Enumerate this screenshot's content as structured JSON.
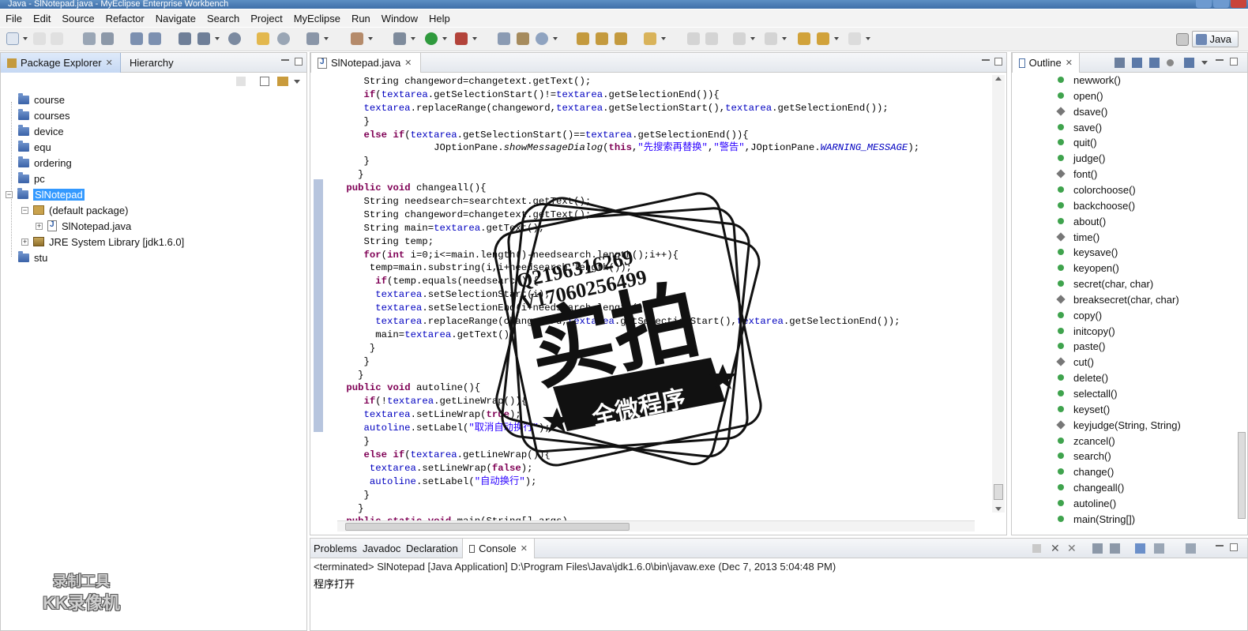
{
  "window": {
    "title": "Java - SlNotepad.java - MyEclipse Enterprise Workbench"
  },
  "menu": [
    "File",
    "Edit",
    "Source",
    "Refactor",
    "Navigate",
    "Search",
    "Project",
    "MyEclipse",
    "Run",
    "Window",
    "Help"
  ],
  "perspective": {
    "label": "Java"
  },
  "package_explorer": {
    "tabs": [
      "Package Explorer",
      "Hierarchy"
    ],
    "items": [
      {
        "label": "course"
      },
      {
        "label": "courses"
      },
      {
        "label": "device"
      },
      {
        "label": "equ"
      },
      {
        "label": "ordering"
      },
      {
        "label": "pc"
      },
      {
        "label": "SlNotepad"
      },
      {
        "label": "(default package)"
      },
      {
        "label": "SlNotepad.java"
      },
      {
        "label": "JRE System Library [jdk1.6.0]"
      },
      {
        "label": "stu"
      }
    ]
  },
  "editor": {
    "tab": "SlNotepad.java",
    "lines": [
      "    String changeword=changetext.getText();",
      "    if(textarea.getSelectionStart()!=textarea.getSelectionEnd()){",
      "    textarea.replaceRange(changeword,textarea.getSelectionStart(),textarea.getSelectionEnd());",
      "    }",
      "    else if(textarea.getSelectionStart()==textarea.getSelectionEnd()){",
      "                JOptionPane.showMessageDialog(this,\"先搜索再替换\",\"警告\",JOptionPane.WARNING_MESSAGE);",
      "    }",
      "   }",
      " public void changeall(){",
      "    String needsearch=searchtext.getText();",
      "    String changeword=changetext.getText();",
      "    String main=textarea.getText();",
      "    String temp;",
      "    for(int i=0;i<=main.length()-needsearch.length();i++){",
      "     temp=main.substring(i,i+needsearch.length());",
      "      if(temp.equals(needsearch)){",
      "      textarea.setSelectionStart(i);",
      "      textarea.setSelectionEnd(i+needsearch.length());",
      "      textarea.replaceRange(changeword,textarea.getSelectionStart(),textarea.getSelectionEnd());",
      "      main=textarea.getText();",
      "     }",
      "    }",
      "   }",
      " public void autoline(){",
      "    if(!textarea.getLineWrap()){",
      "    textarea.setLineWrap(true);",
      "    autoline.setLabel(\"取消自动换行\");",
      "    }",
      "    else if(textarea.getLineWrap()){",
      "     textarea.setLineWrap(false);",
      "     autoline.setLabel(\"自动换行\");",
      "    }",
      "   }",
      " public static void main(String[] args)"
    ]
  },
  "outline": {
    "tab": "Outline",
    "items": [
      {
        "label": "newwork()",
        "kind": "public"
      },
      {
        "label": "open()",
        "kind": "public"
      },
      {
        "label": "dsave()",
        "kind": "default"
      },
      {
        "label": "save()",
        "kind": "public"
      },
      {
        "label": "quit()",
        "kind": "public"
      },
      {
        "label": "judge()",
        "kind": "public"
      },
      {
        "label": "font()",
        "kind": "default"
      },
      {
        "label": "colorchoose()",
        "kind": "public"
      },
      {
        "label": "backchoose()",
        "kind": "public"
      },
      {
        "label": "about()",
        "kind": "public"
      },
      {
        "label": "time()",
        "kind": "default"
      },
      {
        "label": "keysave()",
        "kind": "public"
      },
      {
        "label": "keyopen()",
        "kind": "public"
      },
      {
        "label": "secret(char, char)",
        "kind": "public"
      },
      {
        "label": "breaksecret(char, char)",
        "kind": "default"
      },
      {
        "label": "copy()",
        "kind": "public"
      },
      {
        "label": "initcopy()",
        "kind": "public"
      },
      {
        "label": "paste()",
        "kind": "public"
      },
      {
        "label": "cut()",
        "kind": "default"
      },
      {
        "label": "delete()",
        "kind": "public"
      },
      {
        "label": "selectall()",
        "kind": "public"
      },
      {
        "label": "keyset()",
        "kind": "public"
      },
      {
        "label": "keyjudge(String, String)",
        "kind": "default"
      },
      {
        "label": "zcancel()",
        "kind": "public"
      },
      {
        "label": "search()",
        "kind": "public"
      },
      {
        "label": "change()",
        "kind": "public"
      },
      {
        "label": "changeall()",
        "kind": "public"
      },
      {
        "label": "autoline()",
        "kind": "public"
      },
      {
        "label": "main(String[])",
        "kind": "static"
      }
    ]
  },
  "console": {
    "tabs": [
      "Problems",
      "Javadoc",
      "Declaration",
      "Console"
    ],
    "terminated": "<terminated> SlNotepad [Java Application] D:\\Program Files\\Java\\jdk1.6.0\\bin\\javaw.exe (Dec 7, 2013 5:04:48 PM)",
    "output": "程序打开"
  },
  "overlay": {
    "recorder": [
      "录制工具",
      "KK录像机"
    ],
    "stamp_text": [
      "Q2196316269",
      "V17060256499",
      "实拍",
      "全微程序"
    ]
  },
  "colors": {
    "selection": "#3399ff",
    "keyword": "#7f0055",
    "field": "#0000c0",
    "string": "#2a00ff"
  }
}
